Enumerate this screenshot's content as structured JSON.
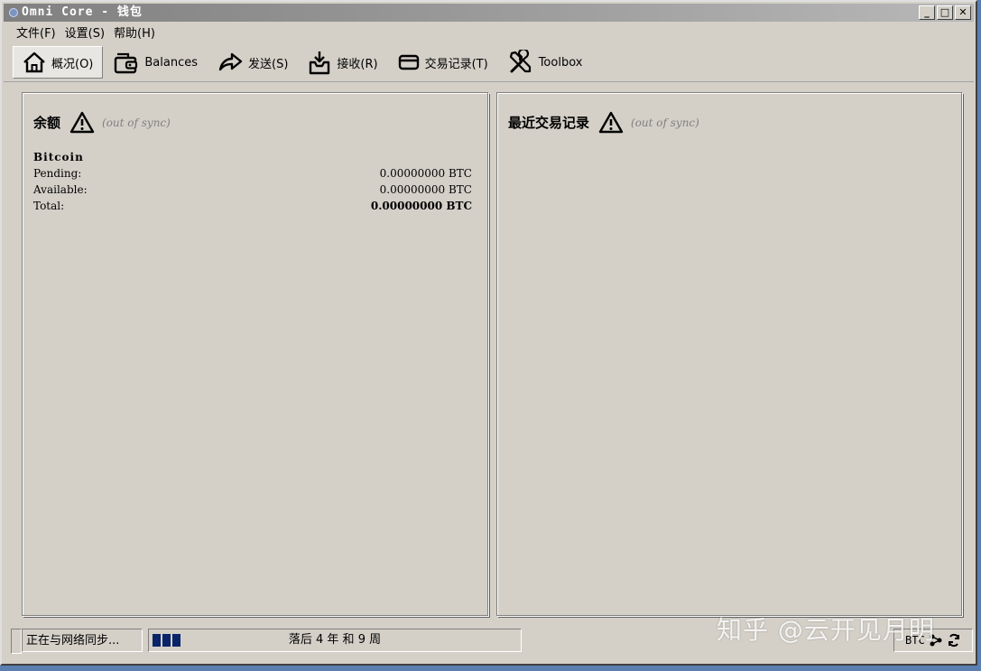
{
  "window": {
    "title": "Omni Core - 钱包"
  },
  "menu": [
    "文件(F)",
    "设置(S)",
    "帮助(H)"
  ],
  "toolbar": {
    "overview": "概况(O)",
    "balances": "Balances",
    "send": "发送(S)",
    "receive": "接收(R)",
    "transactions": "交易记录(T)",
    "toolbox": "Toolbox"
  },
  "balance_panel": {
    "title": "余额",
    "sync_status": "(out of sync)",
    "currency": "Bitcoin",
    "rows": [
      {
        "label": "Pending:",
        "value": "0.00000000 BTC"
      },
      {
        "label": "Available:",
        "value": "0.00000000 BTC"
      },
      {
        "label": "Total:",
        "value": "0.00000000 BTC"
      }
    ]
  },
  "recent_panel": {
    "title": "最近交易记录",
    "sync_status": "(out of sync)"
  },
  "statusbar": {
    "sync_text": "正在与网络同步...",
    "progress_text": "落后 4 年 和 9 周",
    "progress_blocks": 3,
    "unit": "BTC"
  },
  "watermark": "知乎 @云开见月明",
  "colors": {
    "progress": "#0a246a",
    "window_bg": "#d4d0c8",
    "desktop": "#5a7fb0"
  }
}
